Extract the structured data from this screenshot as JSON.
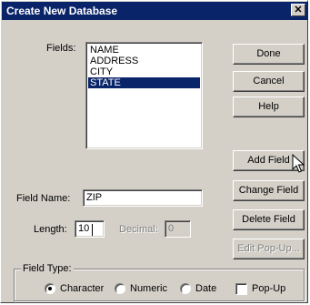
{
  "window": {
    "title": "Create New Database",
    "close_glyph": "✕"
  },
  "fields": {
    "label": "Fields:",
    "items": [
      "NAME",
      "ADDRESS",
      "CITY",
      "STATE"
    ],
    "selected_index": 3
  },
  "buttons": {
    "done": "Done",
    "cancel": "Cancel",
    "help": "Help",
    "add_field": "Add Field",
    "change_field": "Change Field",
    "delete_field": "Delete Field",
    "edit_popup": "Edit Pop-Up..."
  },
  "field_name": {
    "label": "Field Name:",
    "value": "ZIP"
  },
  "length": {
    "label": "Length:",
    "value": "10"
  },
  "decimal": {
    "label": "Decimal:",
    "value": "0"
  },
  "field_type": {
    "label": "Field Type:",
    "options": [
      "Character",
      "Numeric",
      "Date"
    ],
    "selected": "Character",
    "popup_label": "Pop-Up",
    "popup_checked": false
  },
  "colors": {
    "title_bar": "#0a246a",
    "face": "#d4d0c8",
    "selection": "#0a246a"
  },
  "icons": {
    "cursor": "arrow-pointer-icon"
  }
}
